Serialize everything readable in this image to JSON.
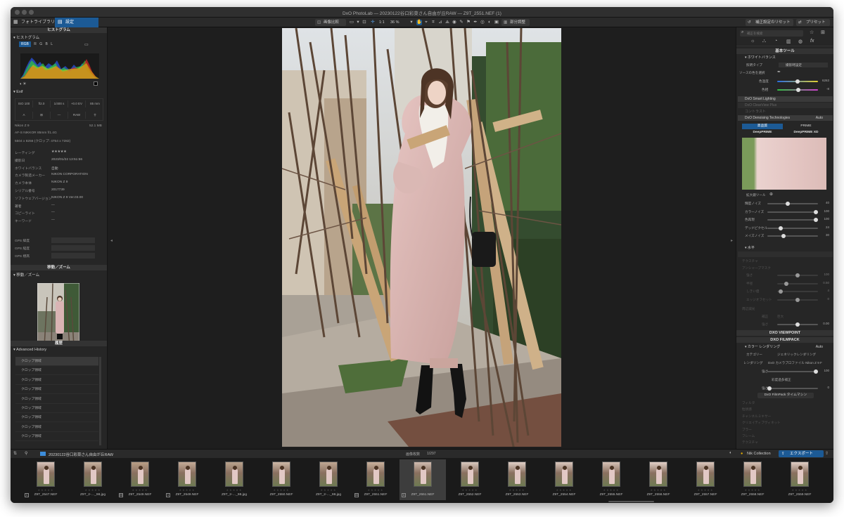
{
  "window": {
    "title": "DxO PhotoLab — 20230122谷口彩菜さん自由が丘RAW — Z9T_2551.NEF (1)"
  },
  "tabs": [
    {
      "label": "フォトライブラリ"
    },
    {
      "label": "設定"
    }
  ],
  "toolbar": {
    "compare": "画像比較",
    "one_to_one": "1:1",
    "zoom": "36 %",
    "local_adjust": "部分調整",
    "reset": "補正設定のリセット",
    "preset": "プリセット"
  },
  "left": {
    "histogram_title": "ヒストグラム",
    "histogram_sub": "ヒストグラム",
    "channels": [
      "RGB",
      "R",
      "G",
      "B",
      "L"
    ],
    "exif_title": "Exif",
    "exif_cells": [
      "ISO 100",
      "f/2.0",
      "1/400 s",
      "+0.0 EV",
      "85 mm"
    ],
    "exif_cells2": [
      "A",
      "",
      "—",
      "RAW",
      ""
    ],
    "camera": "Nikon Z 9",
    "file_size": "52.1 MB",
    "lens": "AF-S NIKKOR 85mm f/1.4G",
    "dims": "5504 x 8256 (クロップ: 4754 x 7282)",
    "meta": [
      {
        "k": "レーティング",
        "v": "★★★★★"
      },
      {
        "k": "撮影日",
        "v": "2023/01/22 13:51:56"
      },
      {
        "k": "ホワイトバランス",
        "v": "自動"
      },
      {
        "k": "カメラ製造メーカー",
        "v": "NIKON CORPORATION"
      },
      {
        "k": "カメラ本体",
        "v": "NIKON Z 9"
      },
      {
        "k": "シリアル番号",
        "v": "2017739"
      },
      {
        "k": "ソフトウェアバージョン",
        "v": "NIKON Z 9 Ver.03.00"
      },
      {
        "k": "著者",
        "v": "—"
      },
      {
        "k": "コピーライト",
        "v": "—"
      },
      {
        "k": "キーワード",
        "v": "—"
      }
    ],
    "gps": [
      "GPS 緯度",
      "GPS 経度",
      "GPS 標高"
    ],
    "nav_title": "移動／ズーム",
    "nav_sub": "移動／ズーム",
    "history_title": "履歴",
    "history_sub": "Advanced History",
    "history_items": [
      "クロップ領域",
      "クロップ領域",
      "クロップ領域",
      "クロップ領域",
      "クロップ領域",
      "クロップ領域",
      "クロップ領域",
      "クロップ領域",
      "クロップ領域"
    ]
  },
  "right": {
    "search_placeholder": "補正を検索",
    "basic_title": "基本ツール",
    "wb_title": "ホワイトバランス",
    "wb_type_label": "照明タイプ",
    "wb_type_value": "撮影時設定",
    "wb_source": "ソースの色を選択",
    "temp_label": "色温度",
    "temp_value": "6263",
    "tint_label": "色相",
    "tint_value": "-8",
    "smart_lighting": "DxO Smart Lighting",
    "clearview": "DxO ClearView Plus",
    "contrast": "コントラスト",
    "denoise": "DxO Denoising Technologies",
    "denoise_mode": "Auto",
    "hq": "高品質",
    "prime": "PRIME",
    "deepprime": "DeepPRIME",
    "deepprime_xd": "DeepPRIME XD",
    "loupe": "拡大鏡ツール",
    "noise_sliders": [
      {
        "label": "輝度ノイズ",
        "value": "40",
        "pos": 0.4
      },
      {
        "label": "カラーノイズ",
        "value": "100",
        "pos": 1.0
      },
      {
        "label": "色再現",
        "value": "100",
        "pos": 1.0
      },
      {
        "label": "デッドピクセル",
        "value": "24",
        "pos": 0.24
      },
      {
        "label": "メイズノイズ",
        "value": "30",
        "pos": 0.3
      }
    ],
    "horizon": "水平",
    "detail_tools": [
      "テクスチャ",
      "アンシャープマスク"
    ],
    "usm_sliders": [
      {
        "label": "強さ",
        "value": "100",
        "pos": 0.5
      },
      {
        "label": "半径",
        "value": "0.50",
        "pos": 0.2
      },
      {
        "label": "しきい値",
        "value": "4",
        "pos": 0.04
      },
      {
        "label": "エッジオフセット",
        "value": "0",
        "pos": 0.5
      }
    ],
    "vignette": "周辺減光",
    "vig_mode_label": "補正",
    "vig_mode_value": "巨大",
    "vig_strength_label": "強さ",
    "vig_strength_value": "0.00",
    "viewpoint": "DXO VIEWPOINT",
    "filmpack": "DXO FILMPACK",
    "color_render": "カラー レンダリング",
    "color_render_mode": "Auto",
    "category_label": "カテゴリー",
    "category_value": "ジェネリックレンダリング",
    "render_label": "レンダリング",
    "render_value": "DxO カメラプロファイル Nikon Z 9 F",
    "render_strength_label": "強さ",
    "render_strength_value": "100",
    "saturation_fix": "彩度過多補正",
    "sat_strength_label": "強さ",
    "sat_strength_value": "0",
    "timemachine": "DxO FilmPack タイムマシン",
    "more_tools": [
      "フィルタ",
      "粒状感",
      "チャンネルミキサー",
      "クリエイティブヴィネット",
      "ブラー",
      "フレーム",
      "テクスチャ"
    ]
  },
  "bottom": {
    "folder": "20230122谷口彩菜さん自由が丘RAW",
    "count_label": "画像枚数",
    "count": "1/297",
    "nik": "Nik Collection",
    "export": "エクスポート"
  },
  "filmstrip": [
    {
      "name": "Z9T_2547.NEF",
      "badge": "1"
    },
    {
      "name": "Z9T_2-…_98.jpg",
      "badge": ""
    },
    {
      "name": "Z9T_2549.NEF",
      "badge": "M"
    },
    {
      "name": "Z9T_2549.NEF",
      "badge": "1"
    },
    {
      "name": "Z9T_2-…_98.jpg",
      "badge": ""
    },
    {
      "name": "Z9T_2550.NEF",
      "badge": ""
    },
    {
      "name": "Z9T_2-…_98.jpg",
      "badge": ""
    },
    {
      "name": "Z9T_2551.NEF",
      "badge": "M"
    },
    {
      "name": "Z9T_2551.NEF",
      "badge": "1"
    },
    {
      "name": "Z9T_2552.NEF",
      "badge": ""
    },
    {
      "name": "Z9T_2553.NEF",
      "badge": ""
    },
    {
      "name": "Z9T_2554.NEF",
      "badge": ""
    },
    {
      "name": "Z9T_2555.NEF",
      "badge": ""
    },
    {
      "name": "Z9T_2556.NEF",
      "badge": ""
    },
    {
      "name": "Z9T_2557.NEF",
      "badge": ""
    },
    {
      "name": "Z9T_2558.NEF",
      "badge": ""
    },
    {
      "name": "Z9T_2559.NEF",
      "badge": ""
    }
  ],
  "filmstrip_selected": 8,
  "colors": {
    "accent": "#1c5a95",
    "panel": "#262626",
    "background": "#1e1e1e"
  }
}
